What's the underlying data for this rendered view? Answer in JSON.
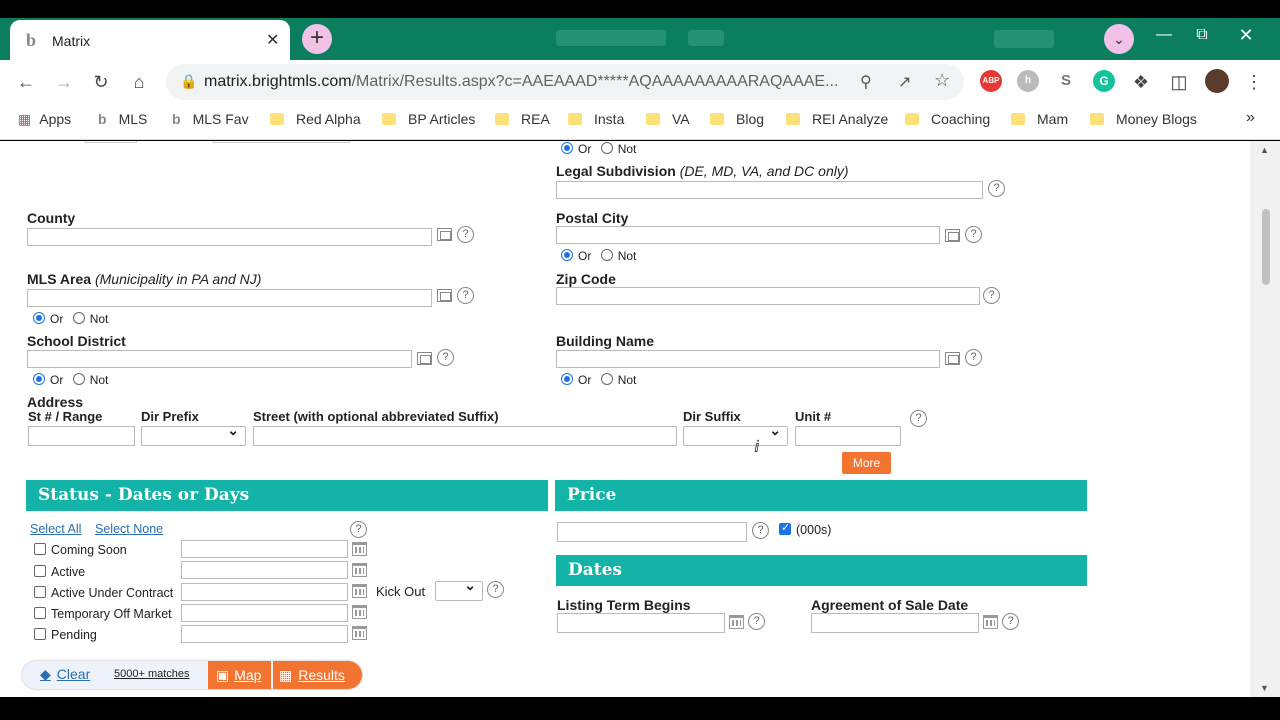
{
  "browser": {
    "tab_title": "Matrix",
    "tab_favicon": "b",
    "tab_close": "✕",
    "new_tab": "+",
    "url_domain": "matrix.brightmls.com",
    "url_path": "/Matrix/Results.aspx?c=AAEAAAD*****AQAAAAAAAAARAQAAAE...",
    "extensions": [
      "ABP",
      "S",
      "G"
    ],
    "bookmarks": [
      "Apps",
      "MLS",
      "MLS Fav",
      "Red Alpha",
      "BP Articles",
      "REA",
      "Insta",
      "VA",
      "Blog",
      "REI Analyze",
      "Coaching",
      "Mam",
      "Money Blogs"
    ],
    "more_bookmarks": "»"
  },
  "form": {
    "or_label": "Or",
    "not_label": "Not",
    "legal_subdivision_label": "Legal Subdivision",
    "legal_subdivision_note": "(DE, MD, VA, and DC only)",
    "county_label": "County",
    "postal_city_label": "Postal City",
    "mls_area_label": "MLS Area",
    "mls_area_note": "(Municipality in PA and NJ)",
    "zip_code_label": "Zip Code",
    "school_district_label": "School District",
    "building_name_label": "Building Name",
    "address_label": "Address",
    "st_range_label": "St # / Range",
    "dir_prefix_label": "Dir Prefix",
    "street_label": "Street (with optional abbreviated Suffix)",
    "dir_suffix_label": "Dir Suffix",
    "unit_label": "Unit #",
    "more_button": "More",
    "help_glyph": "?"
  },
  "status": {
    "title": "Status - Dates or Days",
    "select_all": "Select All",
    "select_none": "Select None",
    "items": [
      "Coming Soon",
      "Active",
      "Active Under Contract",
      "Temporary Off Market",
      "Pending"
    ],
    "kick_out_label": "Kick Out"
  },
  "price": {
    "title": "Price",
    "units_label": "(000s)",
    "units_checked": true
  },
  "dates": {
    "title": "Dates",
    "listing_term_label": "Listing Term Begins",
    "agreement_label": "Agreement of Sale Date"
  },
  "bottom_bar": {
    "clear": "Clear",
    "matches": "5000+ matches",
    "map": "Map",
    "results": "Results"
  },
  "colors": {
    "band": "#14b3a8",
    "button": "#f37331",
    "link": "#2a6fb0",
    "chrome_frame": "#0b7e5f"
  }
}
